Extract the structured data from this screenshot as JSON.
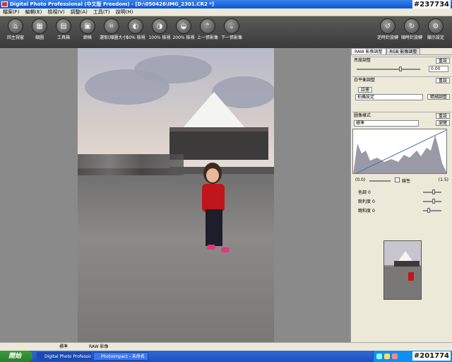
{
  "window": {
    "title": "Digital Photo Professional (中文版 Freedom) - [D:\\050426\\IMG_2301.CR2 *]"
  },
  "watermarks": {
    "top_right": "#237734",
    "bottom_right": "#201774"
  },
  "menu": [
    "檔案(F)",
    "編輯(E)",
    "檢視(V)",
    "調整(A)",
    "工具(T)",
    "說明(H)"
  ],
  "toolbar": [
    {
      "label": "回主視窗",
      "icon": "home-icon"
    },
    {
      "label": "縮圖",
      "icon": "thumbnail-icon"
    },
    {
      "label": "工具箱",
      "icon": "toolbox-icon"
    },
    {
      "label": "網格",
      "icon": "grid-icon"
    },
    {
      "label": "選取(縮圖大小)",
      "icon": "crop-icon"
    },
    {
      "label": "50% 檢視",
      "icon": "zoom-50-icon"
    },
    {
      "label": "100% 檢視",
      "icon": "zoom-100-icon"
    },
    {
      "label": "200% 檢視",
      "icon": "zoom-200-icon"
    },
    {
      "label": "上一張影像",
      "icon": "arrow-up-icon"
    },
    {
      "label": "下一張影像",
      "icon": "arrow-down-icon"
    },
    {
      "label": "逆時針旋轉",
      "icon": "rotate-left-icon"
    },
    {
      "label": "順時針旋轉",
      "icon": "rotate-right-icon"
    },
    {
      "label": "顯示設定",
      "icon": "settings-icon"
    }
  ],
  "panel": {
    "tabs": [
      "RAW 影像調整",
      "RGB 影像調整"
    ],
    "brightness": {
      "title": "亮度調整",
      "reset": "重設",
      "value": "0.00"
    },
    "white_balance": {
      "title": "白平衡調整",
      "reset": "重設",
      "mode": "拍攝設定",
      "register_btn": "註冊",
      "tune_btn": "精細調整"
    },
    "picture_style": {
      "title": "圖像樣式",
      "reset": "重設",
      "style": "標準",
      "browse_btn": "瀏覽"
    },
    "histogram": {
      "left_val": "(0.0)",
      "right_val": "(1.5)",
      "linear_label": "線性"
    },
    "sliders": [
      {
        "label": "色調",
        "value": 0
      },
      {
        "label": "銳利度",
        "value": 0
      },
      {
        "label": "飽和度",
        "value": 0
      }
    ]
  },
  "status": {
    "left": "標準",
    "right": "RAW 影像"
  },
  "taskbar": {
    "start": "開始",
    "tasks": [
      "Digital Photo Professio...",
      "PhotoImpact - 未命名"
    ]
  }
}
